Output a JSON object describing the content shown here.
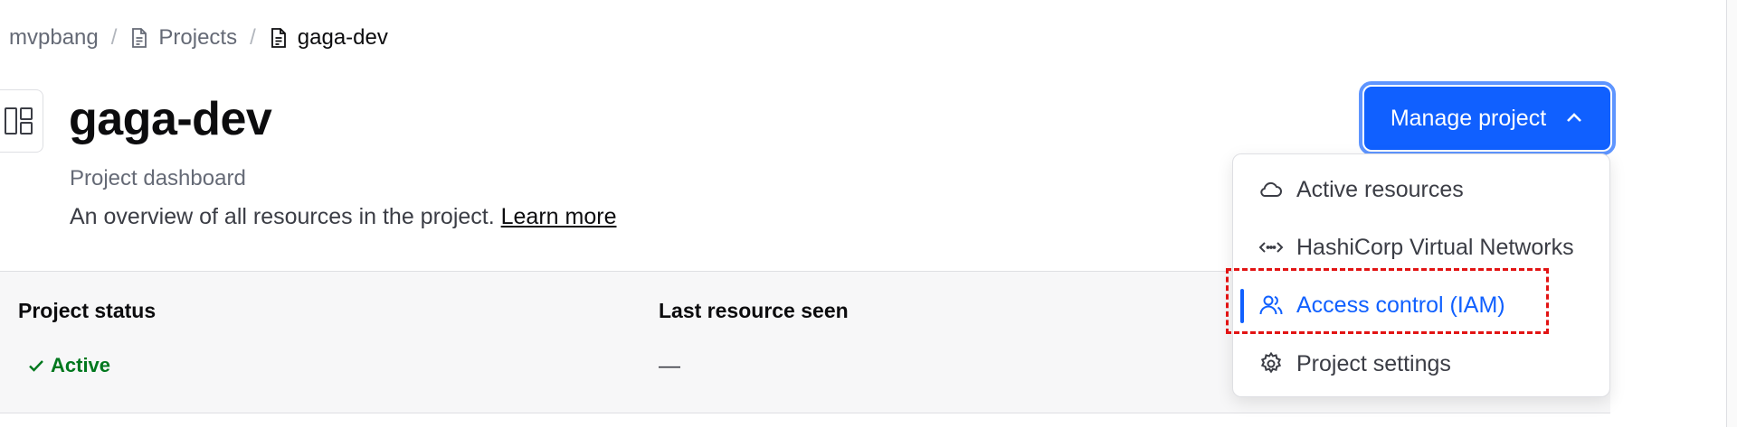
{
  "breadcrumb": {
    "org": "mvpbang",
    "projects": "Projects",
    "current": "gaga-dev",
    "separator": "/"
  },
  "header": {
    "title": "gaga-dev",
    "subtitle": "Project dashboard",
    "description": "An overview of all resources in the project.",
    "learn_more": "Learn more"
  },
  "status": {
    "project_status_label": "Project status",
    "project_status_value": "Active",
    "last_resource_label": "Last resource seen",
    "last_resource_value": "—"
  },
  "manage_button": {
    "label": "Manage project"
  },
  "menu": {
    "items": [
      {
        "label": "Active resources",
        "icon": "cloud-icon"
      },
      {
        "label": "HashiCorp Virtual Networks",
        "icon": "network-icon"
      },
      {
        "label": "Access control (IAM)",
        "icon": "users-icon"
      },
      {
        "label": "Project settings",
        "icon": "gear-icon"
      }
    ]
  },
  "colors": {
    "accent": "#1060ff",
    "success": "#00781e",
    "highlight": "#e21313"
  }
}
